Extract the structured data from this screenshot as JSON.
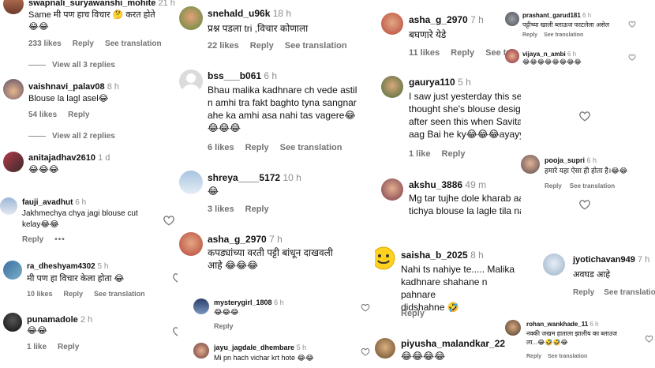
{
  "p1": {
    "c1": {
      "user": "swapnali_suryawanshi_mohite",
      "time": "21 h",
      "text": "Same मी पण हाच विचार 🤔 करत होते\n😂😂",
      "likes": "233 likes",
      "reply": "Reply",
      "translate": "See translation",
      "thread": "View all 3 replies"
    },
    "c2": {
      "user": "vaishnavi_palav08",
      "time": "8 h",
      "text": "Blouse la lagl asel😂",
      "likes": "54 likes",
      "reply": "Reply",
      "thread": "View all 2 replies"
    },
    "c3": {
      "user": "anitajadhav2610",
      "time": "1 d",
      "text": "😂😂😂"
    },
    "c4": {
      "user": "fauji_avadhut",
      "time": "6 h",
      "text": "Jakhmechya chya jagi blouse cut\nkelay😂😂",
      "reply": "Reply",
      "more": "•••"
    },
    "c5": {
      "user": "ra_dheshyam4302",
      "time": "5 h",
      "text": "मी पण हा विचार केला होता 😂",
      "likes": "10 likes",
      "reply": "Reply",
      "translate": "See translation"
    },
    "c6": {
      "user": "punamadole",
      "time": "2 h",
      "text": "😂😂",
      "likes": "1 like",
      "reply": "Reply"
    }
  },
  "p2": {
    "c1": {
      "user": "snehald_u96k",
      "time": "18 h",
      "text": "प्रश्न पडला tri ,विचार कोणाला",
      "likes": "22 likes",
      "reply": "Reply",
      "translate": "See translation"
    },
    "c2": {
      "user": "bss___b061",
      "time": "6 h",
      "text": "Bhau malika kadhnare ch vede astil\nn amhi tra fakt baghto tyna sangnar\nahe ka amhi asa nahi tas vagere😂\n😂😂😂",
      "likes": "6 likes",
      "reply": "Reply",
      "translate": "See translation"
    },
    "c3": {
      "user": "shreya____5172",
      "time": "10 h",
      "text": "😂",
      "likes": "3 likes",
      "reply": "Reply"
    },
    "c4": {
      "user": "asha_g_2970",
      "time": "7 h",
      "text": "कपड्यांच्या वरती पट्टी बांधून दाखवली\nआहे 😂😂😂"
    },
    "c5": {
      "user": "mysterygirl_1808",
      "time": "6 h",
      "text": "😂😂😂",
      "reply": "Reply"
    },
    "c6": {
      "user": "jayu_jagdale_dhembare",
      "time": "5 h",
      "text": "Mi pn hach vichar krt hote 😂😂"
    }
  },
  "p3": {
    "c1": {
      "user": "asha_g_2970",
      "time": "7 h",
      "text": "बघणारे येडे",
      "likes": "11 likes",
      "reply": "Reply",
      "translate": "See tra"
    },
    "c2": {
      "user": "gaurya110",
      "time": "5 h",
      "text": "I saw just yesterday this seen first i\nthought she's blouse designs have\nafter seen this when Savita ji say\naag Bai he ky😂😂😂ayayyooooo",
      "likes": "1 like",
      "reply": "Reply"
    },
    "c3": {
      "user": "akshu_3886",
      "time": "49 m",
      "text": "Mg tar tujhe dole kharab aahet\ntichya blouse la lagle tila nahi 😀"
    },
    "c4": {
      "user": "saisha_b_2025",
      "time": "8 h",
      "text": "Nahi ts nahiye te..... Malika\nkadhnare shahane n pahnare\ndidshahne 🤣",
      "reply": "Reply"
    },
    "c5": {
      "user": "piyusha_malandkar_22",
      "time": "",
      "text": "😂😂😂😂"
    }
  },
  "p4": {
    "c1": {
      "user": "prashant_garud181",
      "time": "6 h",
      "text": "पट्टीच्या खाली ब्लाऊज फाटलेला असेल",
      "reply": "Reply",
      "translate": "See translation"
    },
    "c2": {
      "user": "vijaya_n_ambi",
      "time": "6 h",
      "text": "😂😂😂😂😂😂😂😂"
    },
    "c3": {
      "user": "pooja_supri",
      "time": "6 h",
      "text": "हमारे यहा ऐसा ही होता है।😂😂",
      "reply": "Reply",
      "translate": "See translation"
    },
    "c4": {
      "user": "jyotichavan949",
      "time": "7 h",
      "text": "अवघड आहे",
      "reply": "Reply",
      "translate": "See translatio"
    },
    "c5": {
      "user": "rohan_wankhade_11",
      "time": "6 h",
      "text": "नक्की जखम हाताला झालीय का ब्लाउज\nला...😂🤣🤣😂",
      "reply": "Reply",
      "translate": "See translation"
    }
  },
  "colors": {
    "meta": "#737373",
    "time": "#8e8e8e",
    "text": "#111111"
  }
}
